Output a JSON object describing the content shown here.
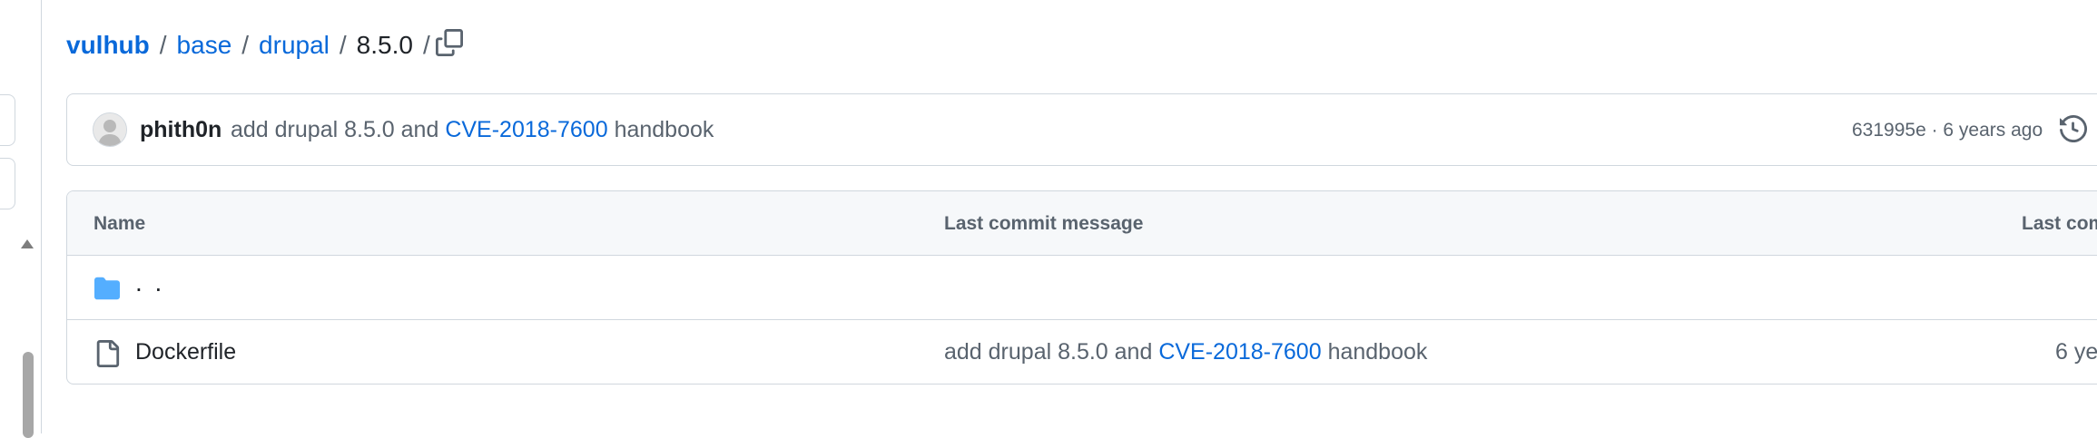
{
  "breadcrumb": {
    "root": "vulhub",
    "items": [
      "base",
      "drupal"
    ],
    "current": "8.5.0",
    "separator": "/",
    "trailing_separator": "/"
  },
  "commit": {
    "author": "phith0n",
    "message_prefix": "add drupal 8.5.0 and",
    "message_link": "CVE-2018-7600",
    "message_suffix": "handbook",
    "meta": "631995e · 6 years ago"
  },
  "table": {
    "headers": {
      "name": "Name",
      "message": "Last commit message",
      "date": "Last com"
    },
    "parent_row": {
      "label": ". ."
    },
    "rows": [
      {
        "name": "Dockerfile",
        "message_prefix": "add drupal 8.5.0 and",
        "message_link": "CVE-2018-7600",
        "message_suffix": "handbook",
        "date": "6 ye"
      }
    ]
  },
  "colors": {
    "link": "#0969da",
    "text": "#1f2328",
    "muted": "#59636e",
    "border": "#d0d7de",
    "header_bg": "#f6f8fa",
    "folder": "#54aeff"
  },
  "icons": [
    "copy-icon",
    "history-icon",
    "folder-icon",
    "file-icon",
    "scroll-up-arrow-icon"
  ]
}
